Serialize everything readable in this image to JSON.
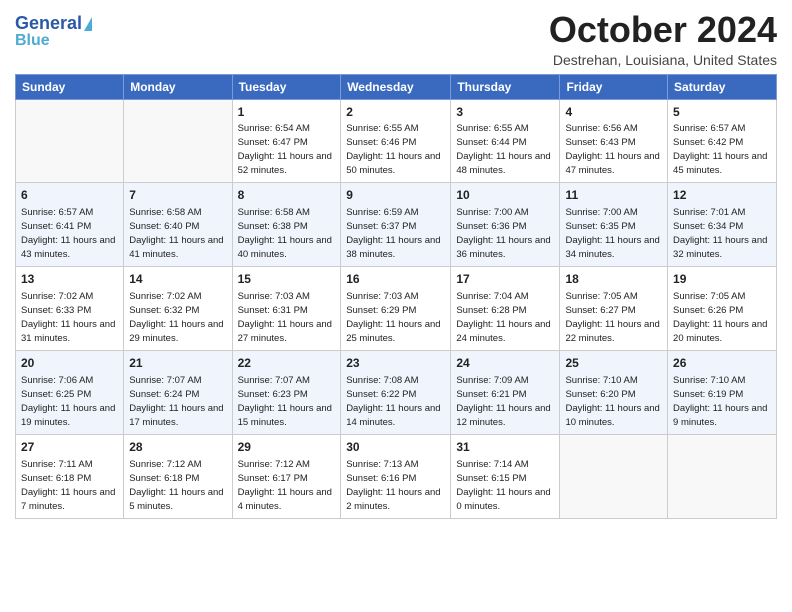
{
  "header": {
    "logo_line1": "General",
    "logo_line2": "Blue",
    "month_title": "October 2024",
    "location": "Destrehan, Louisiana, United States"
  },
  "weekdays": [
    "Sunday",
    "Monday",
    "Tuesday",
    "Wednesday",
    "Thursday",
    "Friday",
    "Saturday"
  ],
  "weeks": [
    [
      {
        "day": "",
        "sunrise": "",
        "sunset": "",
        "daylight": ""
      },
      {
        "day": "",
        "sunrise": "",
        "sunset": "",
        "daylight": ""
      },
      {
        "day": "1",
        "sunrise": "Sunrise: 6:54 AM",
        "sunset": "Sunset: 6:47 PM",
        "daylight": "Daylight: 11 hours and 52 minutes."
      },
      {
        "day": "2",
        "sunrise": "Sunrise: 6:55 AM",
        "sunset": "Sunset: 6:46 PM",
        "daylight": "Daylight: 11 hours and 50 minutes."
      },
      {
        "day": "3",
        "sunrise": "Sunrise: 6:55 AM",
        "sunset": "Sunset: 6:44 PM",
        "daylight": "Daylight: 11 hours and 48 minutes."
      },
      {
        "day": "4",
        "sunrise": "Sunrise: 6:56 AM",
        "sunset": "Sunset: 6:43 PM",
        "daylight": "Daylight: 11 hours and 47 minutes."
      },
      {
        "day": "5",
        "sunrise": "Sunrise: 6:57 AM",
        "sunset": "Sunset: 6:42 PM",
        "daylight": "Daylight: 11 hours and 45 minutes."
      }
    ],
    [
      {
        "day": "6",
        "sunrise": "Sunrise: 6:57 AM",
        "sunset": "Sunset: 6:41 PM",
        "daylight": "Daylight: 11 hours and 43 minutes."
      },
      {
        "day": "7",
        "sunrise": "Sunrise: 6:58 AM",
        "sunset": "Sunset: 6:40 PM",
        "daylight": "Daylight: 11 hours and 41 minutes."
      },
      {
        "day": "8",
        "sunrise": "Sunrise: 6:58 AM",
        "sunset": "Sunset: 6:38 PM",
        "daylight": "Daylight: 11 hours and 40 minutes."
      },
      {
        "day": "9",
        "sunrise": "Sunrise: 6:59 AM",
        "sunset": "Sunset: 6:37 PM",
        "daylight": "Daylight: 11 hours and 38 minutes."
      },
      {
        "day": "10",
        "sunrise": "Sunrise: 7:00 AM",
        "sunset": "Sunset: 6:36 PM",
        "daylight": "Daylight: 11 hours and 36 minutes."
      },
      {
        "day": "11",
        "sunrise": "Sunrise: 7:00 AM",
        "sunset": "Sunset: 6:35 PM",
        "daylight": "Daylight: 11 hours and 34 minutes."
      },
      {
        "day": "12",
        "sunrise": "Sunrise: 7:01 AM",
        "sunset": "Sunset: 6:34 PM",
        "daylight": "Daylight: 11 hours and 32 minutes."
      }
    ],
    [
      {
        "day": "13",
        "sunrise": "Sunrise: 7:02 AM",
        "sunset": "Sunset: 6:33 PM",
        "daylight": "Daylight: 11 hours and 31 minutes."
      },
      {
        "day": "14",
        "sunrise": "Sunrise: 7:02 AM",
        "sunset": "Sunset: 6:32 PM",
        "daylight": "Daylight: 11 hours and 29 minutes."
      },
      {
        "day": "15",
        "sunrise": "Sunrise: 7:03 AM",
        "sunset": "Sunset: 6:31 PM",
        "daylight": "Daylight: 11 hours and 27 minutes."
      },
      {
        "day": "16",
        "sunrise": "Sunrise: 7:03 AM",
        "sunset": "Sunset: 6:29 PM",
        "daylight": "Daylight: 11 hours and 25 minutes."
      },
      {
        "day": "17",
        "sunrise": "Sunrise: 7:04 AM",
        "sunset": "Sunset: 6:28 PM",
        "daylight": "Daylight: 11 hours and 24 minutes."
      },
      {
        "day": "18",
        "sunrise": "Sunrise: 7:05 AM",
        "sunset": "Sunset: 6:27 PM",
        "daylight": "Daylight: 11 hours and 22 minutes."
      },
      {
        "day": "19",
        "sunrise": "Sunrise: 7:05 AM",
        "sunset": "Sunset: 6:26 PM",
        "daylight": "Daylight: 11 hours and 20 minutes."
      }
    ],
    [
      {
        "day": "20",
        "sunrise": "Sunrise: 7:06 AM",
        "sunset": "Sunset: 6:25 PM",
        "daylight": "Daylight: 11 hours and 19 minutes."
      },
      {
        "day": "21",
        "sunrise": "Sunrise: 7:07 AM",
        "sunset": "Sunset: 6:24 PM",
        "daylight": "Daylight: 11 hours and 17 minutes."
      },
      {
        "day": "22",
        "sunrise": "Sunrise: 7:07 AM",
        "sunset": "Sunset: 6:23 PM",
        "daylight": "Daylight: 11 hours and 15 minutes."
      },
      {
        "day": "23",
        "sunrise": "Sunrise: 7:08 AM",
        "sunset": "Sunset: 6:22 PM",
        "daylight": "Daylight: 11 hours and 14 minutes."
      },
      {
        "day": "24",
        "sunrise": "Sunrise: 7:09 AM",
        "sunset": "Sunset: 6:21 PM",
        "daylight": "Daylight: 11 hours and 12 minutes."
      },
      {
        "day": "25",
        "sunrise": "Sunrise: 7:10 AM",
        "sunset": "Sunset: 6:20 PM",
        "daylight": "Daylight: 11 hours and 10 minutes."
      },
      {
        "day": "26",
        "sunrise": "Sunrise: 7:10 AM",
        "sunset": "Sunset: 6:19 PM",
        "daylight": "Daylight: 11 hours and 9 minutes."
      }
    ],
    [
      {
        "day": "27",
        "sunrise": "Sunrise: 7:11 AM",
        "sunset": "Sunset: 6:18 PM",
        "daylight": "Daylight: 11 hours and 7 minutes."
      },
      {
        "day": "28",
        "sunrise": "Sunrise: 7:12 AM",
        "sunset": "Sunset: 6:18 PM",
        "daylight": "Daylight: 11 hours and 5 minutes."
      },
      {
        "day": "29",
        "sunrise": "Sunrise: 7:12 AM",
        "sunset": "Sunset: 6:17 PM",
        "daylight": "Daylight: 11 hours and 4 minutes."
      },
      {
        "day": "30",
        "sunrise": "Sunrise: 7:13 AM",
        "sunset": "Sunset: 6:16 PM",
        "daylight": "Daylight: 11 hours and 2 minutes."
      },
      {
        "day": "31",
        "sunrise": "Sunrise: 7:14 AM",
        "sunset": "Sunset: 6:15 PM",
        "daylight": "Daylight: 11 hours and 0 minutes."
      },
      {
        "day": "",
        "sunrise": "",
        "sunset": "",
        "daylight": ""
      },
      {
        "day": "",
        "sunrise": "",
        "sunset": "",
        "daylight": ""
      }
    ]
  ]
}
